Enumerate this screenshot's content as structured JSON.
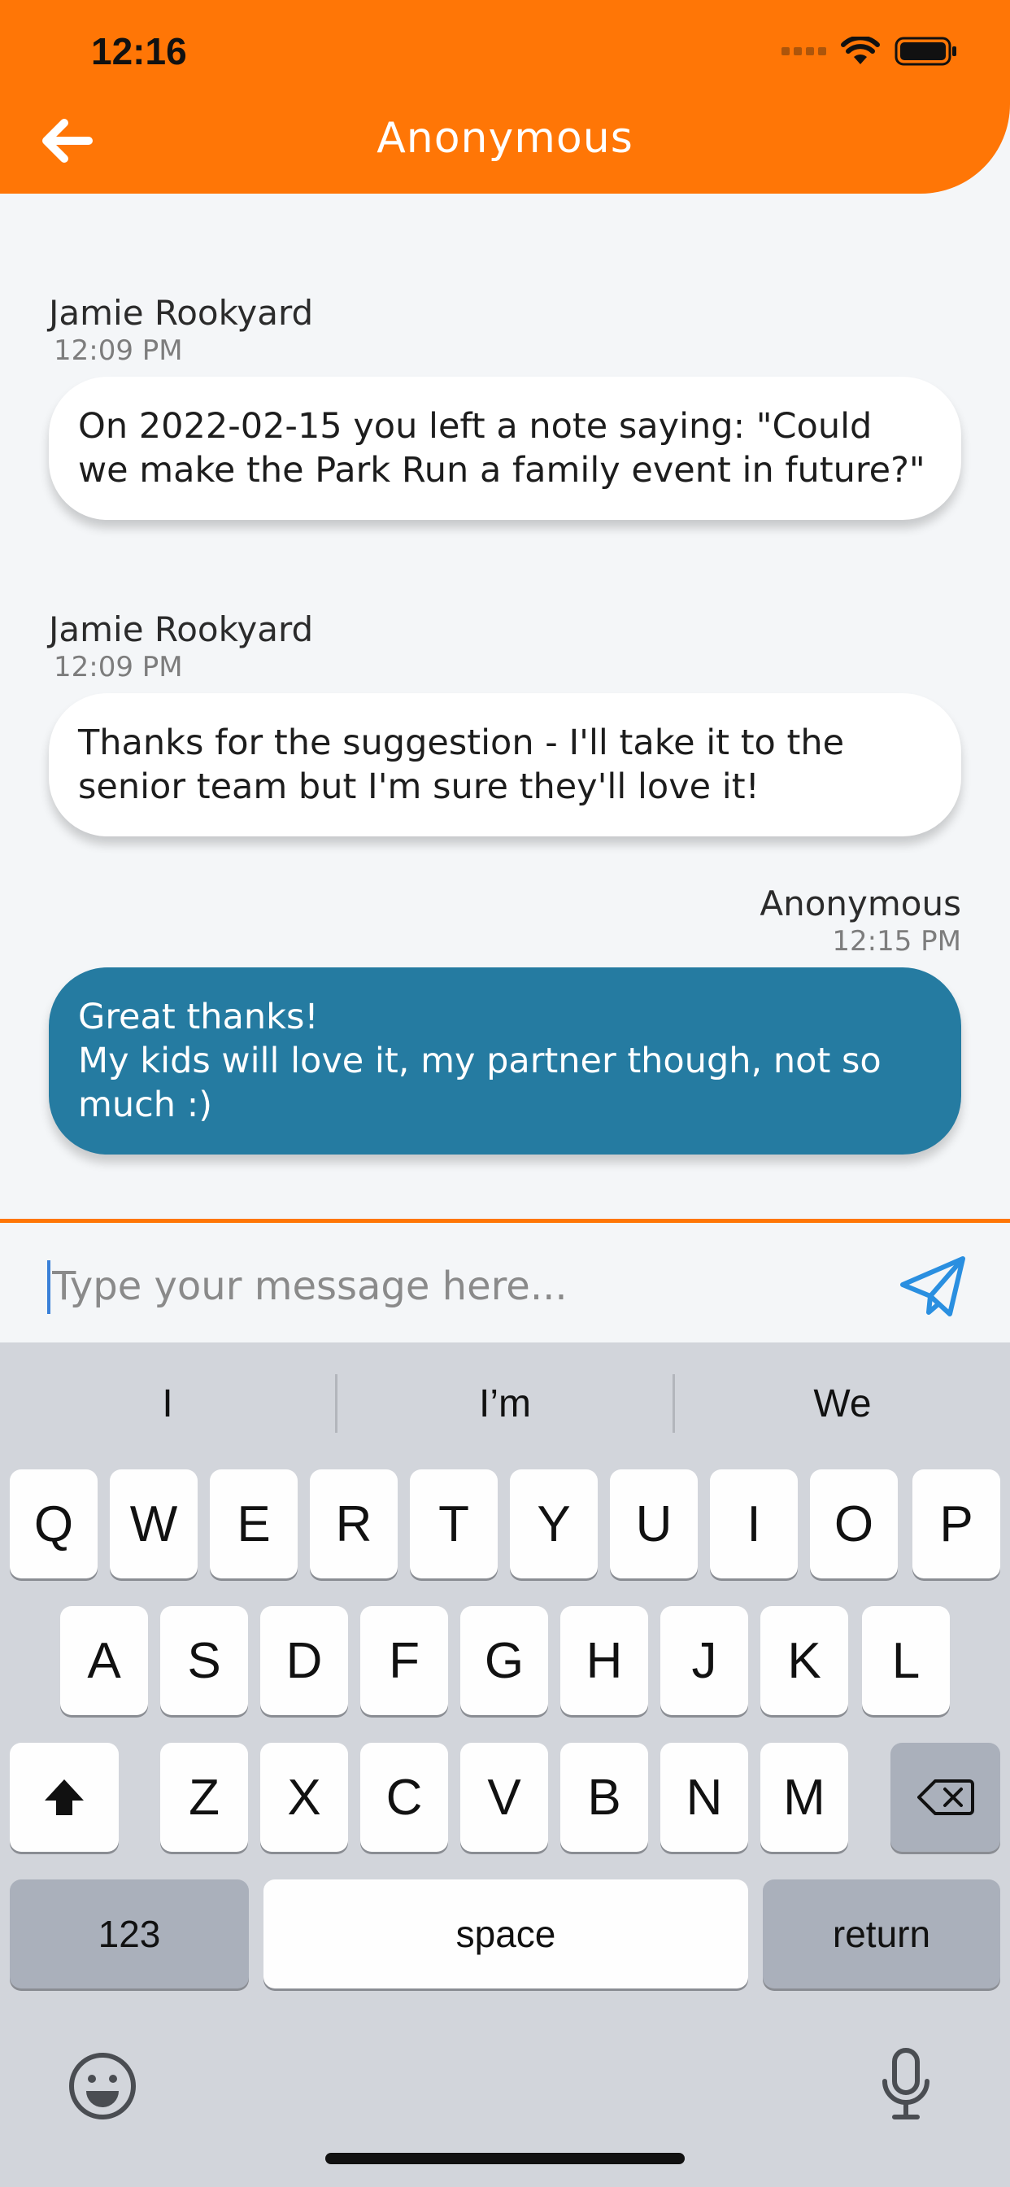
{
  "status": {
    "time": "12:16"
  },
  "header": {
    "title": "Anonymous",
    "back_icon": "arrow-left-icon"
  },
  "messages": [
    {
      "sender": "Jamie Rookyard",
      "time": "12:09 PM",
      "text": "On 2022-02-15 you left a note saying: \"Could we make the Park Run a family event in future?\""
    },
    {
      "sender": "Jamie Rookyard",
      "time": "12:09 PM",
      "text": "Thanks for the suggestion - I'll take it to the senior team but I'm sure they'll love it!"
    },
    {
      "sender": "Anonymous",
      "time": "12:15 PM",
      "text": "Great thanks!\nMy kids will love it, my partner though, not so much :)"
    }
  ],
  "composer": {
    "placeholder": "Type your message here...",
    "send_icon": "send-icon"
  },
  "keyboard": {
    "suggestions": [
      "I",
      "I’m",
      "We"
    ],
    "row1": [
      "Q",
      "W",
      "E",
      "R",
      "T",
      "Y",
      "U",
      "I",
      "O",
      "P"
    ],
    "row2": [
      "A",
      "S",
      "D",
      "F",
      "G",
      "H",
      "J",
      "K",
      "L"
    ],
    "row3": [
      "Z",
      "X",
      "C",
      "V",
      "B",
      "N",
      "M"
    ],
    "numbers_label": "123",
    "space_label": "space",
    "return_label": "return"
  },
  "colors": {
    "accent": "#ff7606",
    "outgoing_bubble": "#257ba1",
    "incoming_bubble": "#ffffff"
  }
}
